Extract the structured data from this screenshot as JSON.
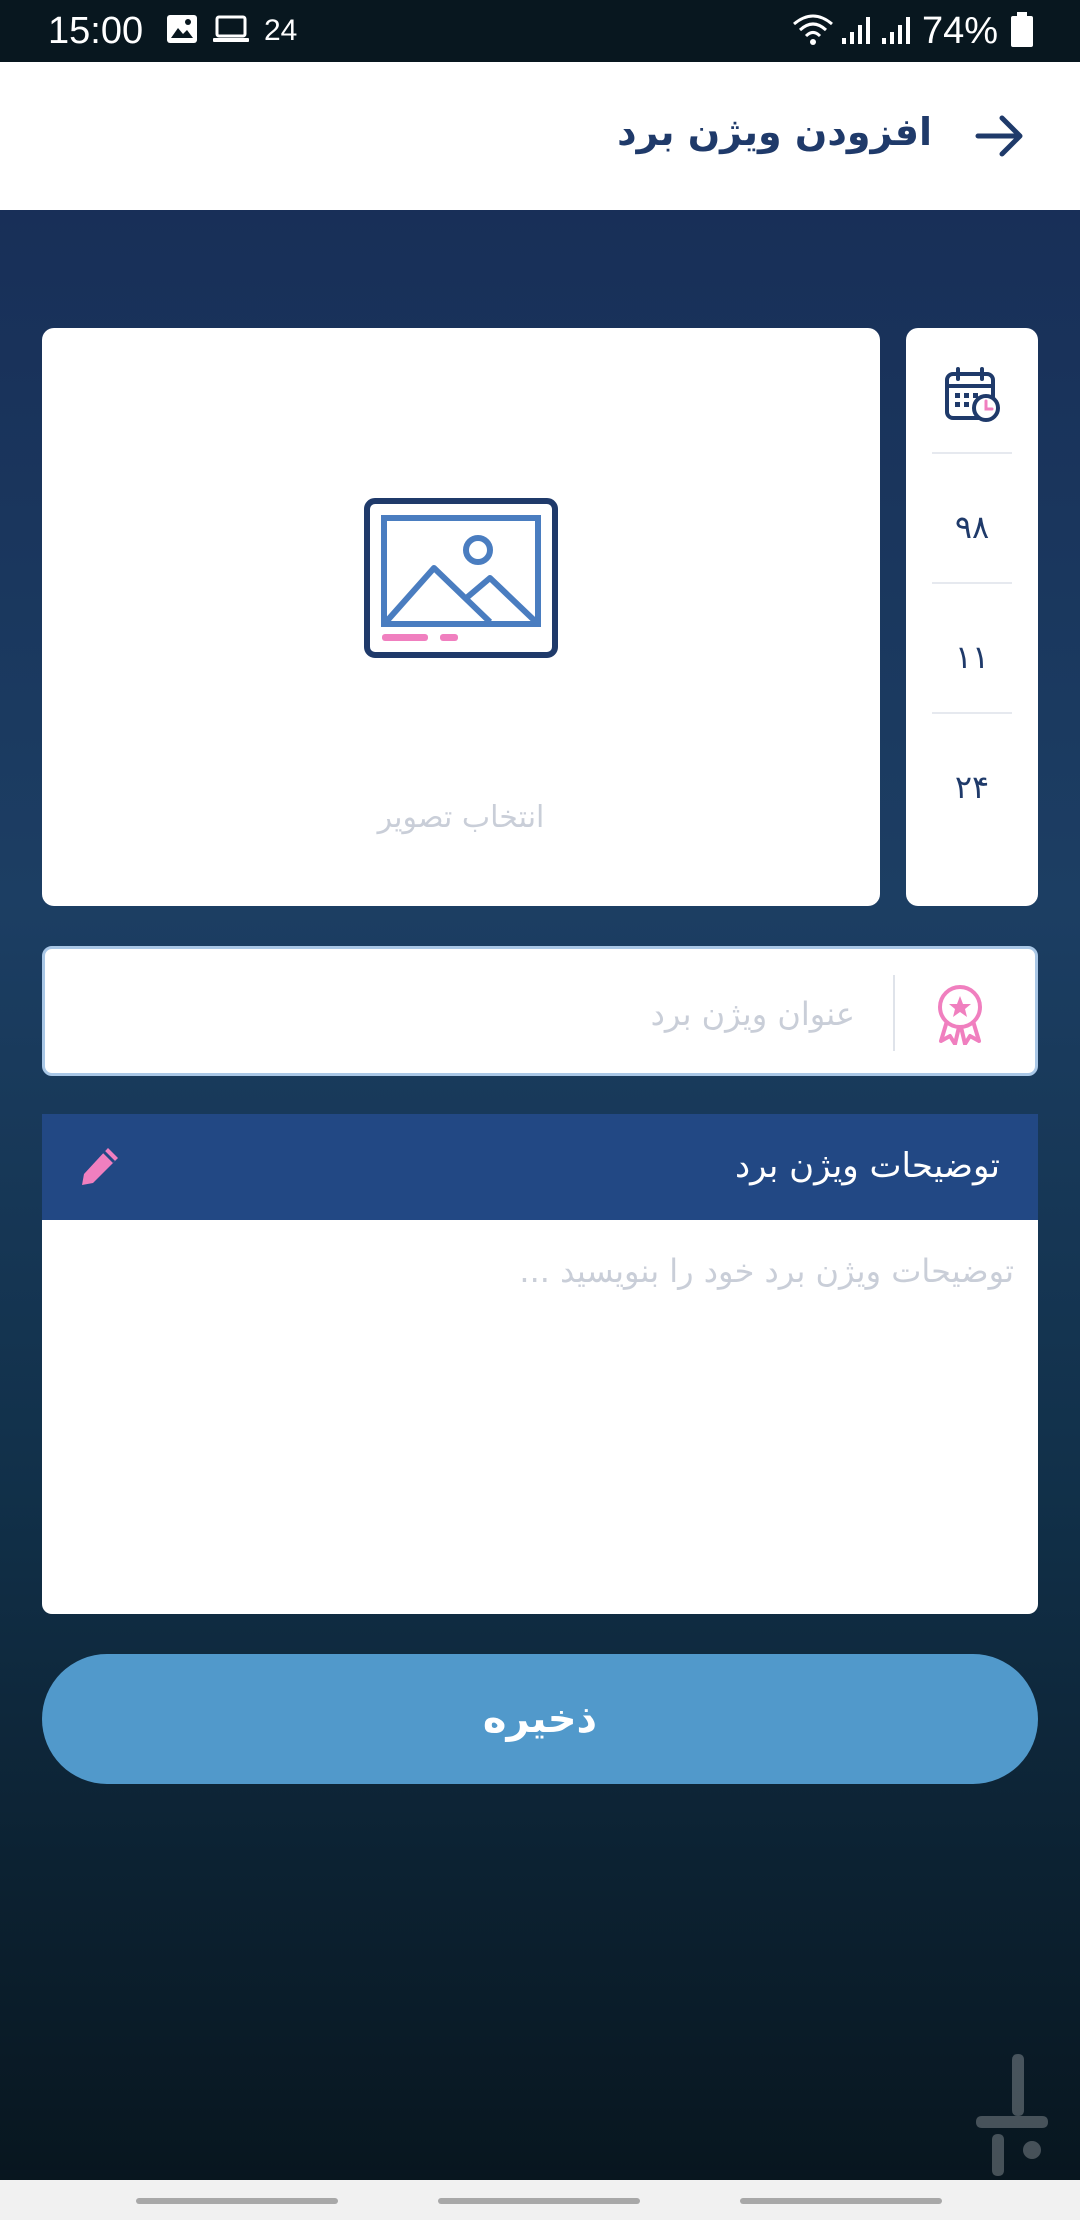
{
  "status_bar": {
    "time": "15:00",
    "notification_count": "24",
    "battery": "74%",
    "icons": [
      "image-icon",
      "laptop-icon",
      "wifi-icon",
      "signal-icon",
      "signal-icon",
      "battery-icon"
    ]
  },
  "app_bar": {
    "title": "افزودن ویژن برد",
    "back_icon": "arrow-right-icon"
  },
  "image_picker": {
    "label": "انتخاب تصویر",
    "icon": "image-placeholder-icon"
  },
  "date": {
    "icon": "calendar-clock-icon",
    "year": "۹۸",
    "month": "۱۱",
    "day": "۲۴"
  },
  "title_field": {
    "placeholder": "عنوان ویژن برد",
    "value": "",
    "icon": "award-badge-icon"
  },
  "description": {
    "header_label": "توضیحات ویژن برد",
    "edit_icon": "pencil-icon",
    "placeholder": "توضیحات ویژن برد خود را بنویسید ...",
    "value": ""
  },
  "save_button": {
    "label": "ذخیره"
  },
  "colors": {
    "primary": "#224884",
    "accent_pink": "#f07fbf",
    "button_blue": "#5199cb",
    "title_text": "#1f3a6a"
  }
}
